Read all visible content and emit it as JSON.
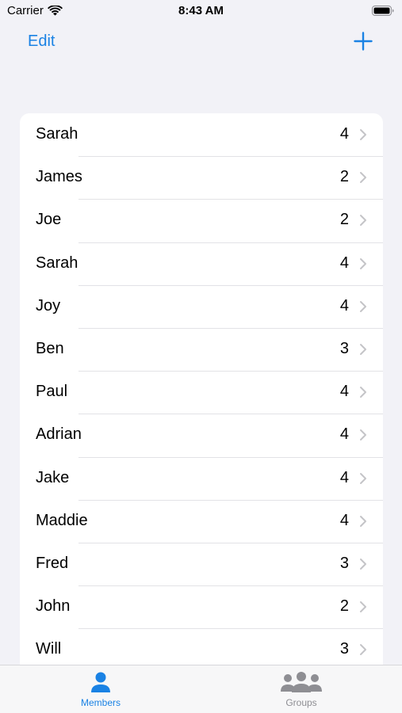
{
  "status_bar": {
    "carrier": "Carrier",
    "time": "8:43 AM",
    "icons": [
      "wifi-icon",
      "battery-icon"
    ]
  },
  "nav": {
    "edit_label": "Edit",
    "add_icon": "plus-icon"
  },
  "members": [
    {
      "name": "Sarah",
      "count": "4"
    },
    {
      "name": "James",
      "count": "2"
    },
    {
      "name": "Joe",
      "count": "2"
    },
    {
      "name": "Sarah",
      "count": "4"
    },
    {
      "name": "Joy",
      "count": "4"
    },
    {
      "name": "Ben",
      "count": "3"
    },
    {
      "name": "Paul",
      "count": "4"
    },
    {
      "name": "Adrian",
      "count": "4"
    },
    {
      "name": "Jake",
      "count": "4"
    },
    {
      "name": "Maddie",
      "count": "4"
    },
    {
      "name": "Fred",
      "count": "3"
    },
    {
      "name": "John",
      "count": "2"
    },
    {
      "name": "Will",
      "count": "3"
    }
  ],
  "tabs": [
    {
      "label": "Members",
      "icon": "person-icon",
      "selected": true
    },
    {
      "label": "Groups",
      "icon": "group-icon",
      "selected": false
    }
  ],
  "colors": {
    "accent": "#1a82e4",
    "background": "#f2f2f7",
    "inactive": "#8e8e93"
  }
}
